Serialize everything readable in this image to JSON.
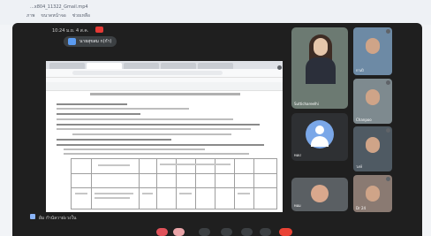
{
  "app": {
    "file_title": "...x804_11322_Gmail.mp4",
    "menu": [
      "ภาพ",
      "ขนาดหน้าจอ",
      "ช่วยเหลือ"
    ]
  },
  "meet": {
    "status_time": "10:24 ม.ย. 4 ส.ค.",
    "presenter_label": "นายสุขสม ก(กำ)",
    "caption_label": "ผ้ม กำนัลวาฝะวงใน"
  },
  "participants": [
    {
      "name": "Suttichareelhi",
      "type": "video"
    },
    {
      "name": "ทอป",
      "type": "avatar"
    },
    {
      "name": "ทอม",
      "type": "video"
    },
    {
      "name": "กาเป้",
      "type": "video"
    },
    {
      "name": "Chanpoo",
      "type": "video"
    },
    {
      "name": "วงษ์",
      "type": "video"
    },
    {
      "name": "Dr 24",
      "type": "video"
    }
  ],
  "controls": [
    "mic-icon",
    "camera-icon",
    "captions-icon",
    "raise-hand-icon",
    "present-icon",
    "more-icon",
    "end-call-icon"
  ]
}
